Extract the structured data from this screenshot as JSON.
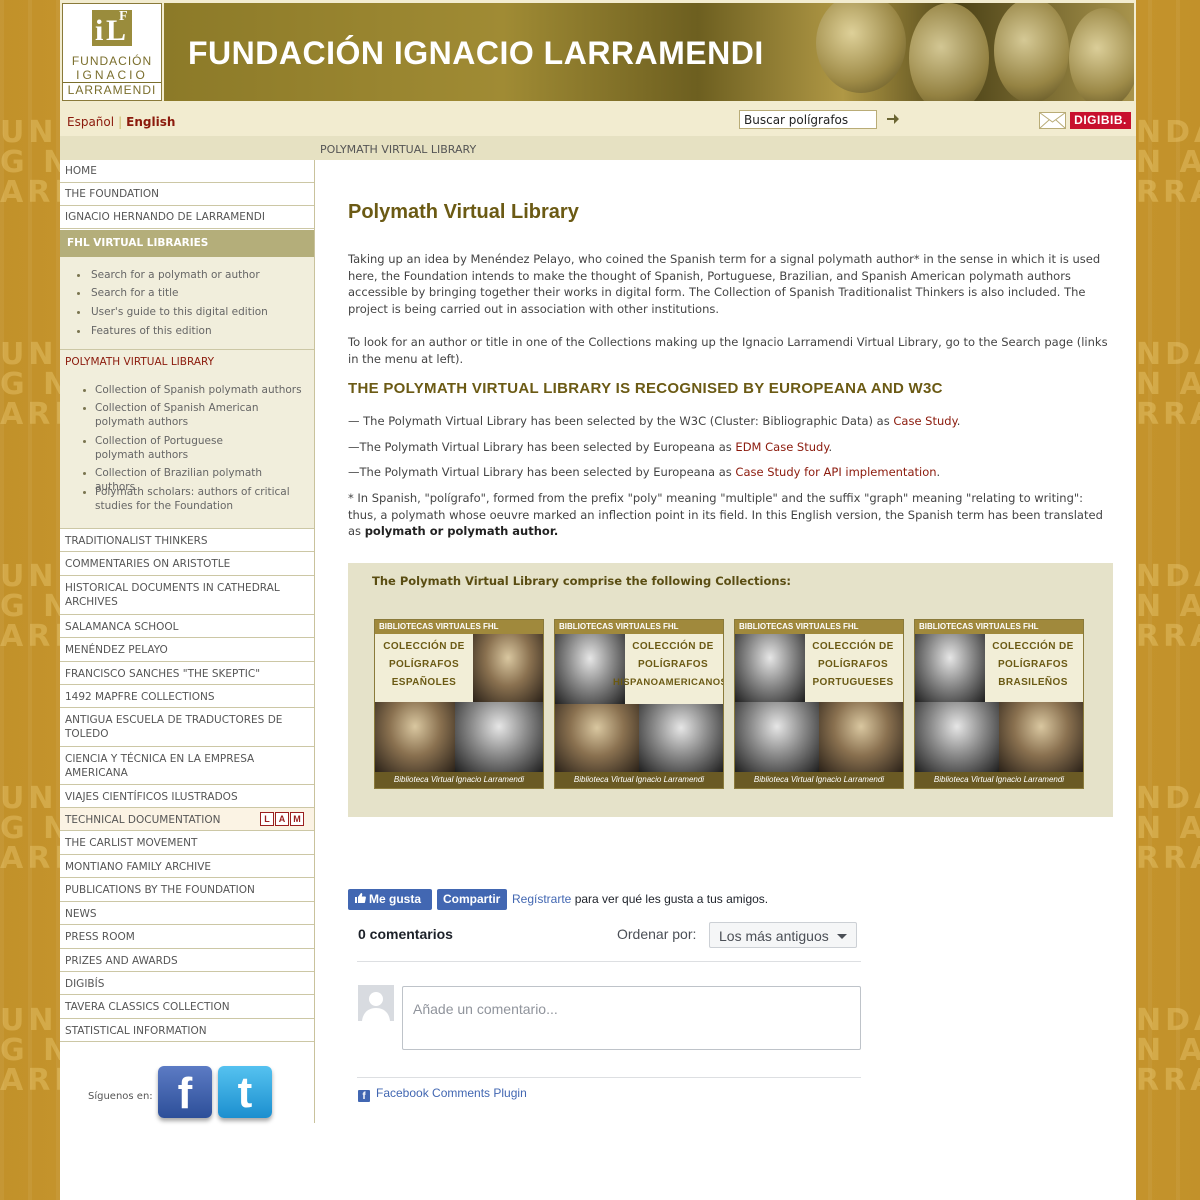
{
  "header": {
    "logo_text": [
      "FUNDACIÓN",
      "IGNACIO",
      "LARRAMENDI"
    ],
    "banner_title": "FUNDACIÓN IGNACIO LARRAMENDI"
  },
  "topbar": {
    "lang_es": "Español",
    "lang_en": "English",
    "search_placeholder": "Buscar polígrafos",
    "digibib": "DIGIBIB."
  },
  "breadcrumb": "POLYMATH VIRTUAL LIBRARY",
  "sidebar": {
    "top_links": [
      "HOME",
      "THE FOUNDATION",
      "IGNACIO HERNANDO DE LARRAMENDI"
    ],
    "section_fhl": "FHL VIRTUAL LIBRARIES",
    "fhl_items": [
      "Search for a polymath or author",
      "Search for a title",
      "User's guide to this digital edition",
      "Features of this edition"
    ],
    "section_polymath": "POLYMATH VIRTUAL LIBRARY",
    "polymath_items": [
      "Collection of Spanish polymath authors",
      "Collection of Spanish American polymath authors",
      "Collection of Portuguese polymath authors",
      "Collection of Brazilian polymath authors",
      "Polymath scholars: authors of critical studies for the Foundation"
    ],
    "bottom_links": [
      "TRADITIONALIST THINKERS",
      "COMMENTARIES ON ARISTOTLE",
      "HISTORICAL DOCUMENTS IN CATHEDRAL ARCHIVES",
      "SALAMANCA SCHOOL",
      "MENÉNDEZ PELAYO",
      "FRANCISCO SANCHES \"THE SKEPTIC\"",
      "1492 MAPFRE COLLECTIONS",
      "ANTIGUA ESCUELA DE TRADUCTORES DE TOLEDO",
      "CIENCIA Y TÉCNICA EN LA EMPRESA AMERICANA",
      "VIAJES CIENTÍFICOS ILUSTRADOS",
      "TECHNICAL DOCUMENTATION",
      "THE CARLIST MOVEMENT",
      "MONTIANO FAMILY ARCHIVE",
      "PUBLICATIONS BY THE FOUNDATION",
      "NEWS",
      "PRESS ROOM",
      "PRIZES AND AWARDS",
      "DIGIBÍS",
      "TAVERA CLASSICS COLLECTION",
      "STATISTICAL INFORMATION"
    ],
    "lam_badge": [
      "L",
      "A",
      "M"
    ],
    "follow_label": "Síguenos en:"
  },
  "main": {
    "title": "Polymath Virtual Library",
    "intro_1": "Taking up an idea by Menéndez Pelayo, who coined the Spanish term for a signal polymath author* in the sense in which it is used here, the Foundation intends to make the thought of Spanish, Portuguese, Brazilian, and Spanish American polymath authors accessible by bringing together their works in digital form. The Collection of Spanish Traditionalist Thinkers is also included. The project is being carried out in association with other institutions.",
    "intro_2": "To look for an author or title in one of the Collections making up the Ignacio Larramendi Virtual Library, go to the Search page (links in the menu at left).",
    "heading": "THE POLYMATH VIRTUAL LIBRARY IS RECOGNISED BY EUROPEANA AND W3C",
    "rec_1_pre": "— The Polymath Virtual Library has been selected by the W3C (Cluster: Bibliographic Data) as ",
    "rec_1_link": "Case Study",
    "rec_1_post": ".",
    "rec_2_pre": "—The Polymath Virtual Library has been selected by Europeana as ",
    "rec_2_link": "EDM Case Study",
    "rec_2_post": ".",
    "rec_3_pre": "—The Polymath Virtual Library has been selected by Europeana as ",
    "rec_3_link": "Case Study for API implementation",
    "rec_3_post": ".",
    "footnote": "* In Spanish, \"polígrafo\", formed from the prefix \"poly\" meaning \"multiple\" and the suffix \"graph\" meaning \"relating to writing\": thus, a polymath whose oeuvre marked an inflection point in its field. In this English version, the Spanish term has been translated as ",
    "footnote_bold": "polymath or polymath author.",
    "collections_title": "The Polymath Virtual Library comprise the following Collections:",
    "cards": [
      {
        "head": "BIBLIOTECAS VIRTUALES FHL",
        "lines": [
          "COLECCIÓN DE",
          "POLÍGRAFOS",
          "ESPAÑOLES"
        ],
        "foot": "Biblioteca Virtual Ignacio Larramendi"
      },
      {
        "head": "BIBLIOTECAS VIRTUALES FHL",
        "lines": [
          "COLECCIÓN DE",
          "POLÍGRAFOS",
          "HISPANOAMERICANOS"
        ],
        "foot": "Biblioteca Virtual Ignacio Larramendi"
      },
      {
        "head": "BIBLIOTECAS VIRTUALES FHL",
        "lines": [
          "COLECCIÓN DE",
          "POLÍGRAFOS",
          "PORTUGUESES"
        ],
        "foot": "Biblioteca Virtual Ignacio Larramendi"
      },
      {
        "head": "BIBLIOTECAS VIRTUALES FHL",
        "lines": [
          "COLECCIÓN DE",
          "POLÍGRAFOS",
          "BRASILEÑOS"
        ],
        "foot": "Biblioteca Virtual Ignacio Larramendi"
      }
    ]
  },
  "facebook": {
    "like": "Me gusta",
    "share": "Compartir",
    "register_link": "Regístrarte",
    "register_rest": " para ver qué les gusta a tus amigos.",
    "comment_count": "0 comentarios",
    "order_label": "Ordenar por:",
    "order_value": "Los más antiguos",
    "comment_placeholder": "Añade un comentario...",
    "plugin_label": "Facebook Comments Plugin"
  },
  "colors": {
    "accent_gold": "#c99a2e",
    "heading_olive": "#6b5a14",
    "link_red": "#8b1a0c",
    "facebook_blue": "#4267b2"
  }
}
